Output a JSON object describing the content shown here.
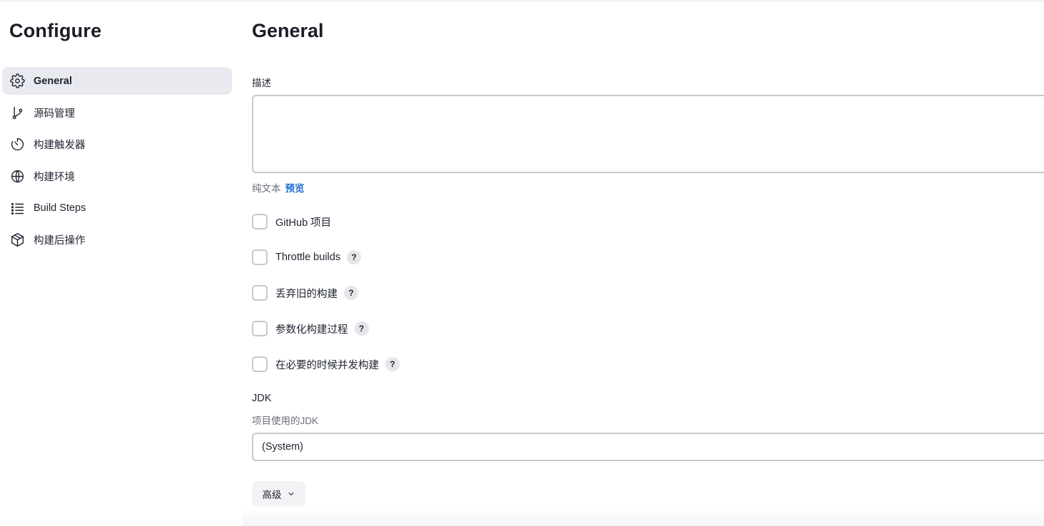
{
  "sidebar": {
    "title": "Configure",
    "items": [
      {
        "label": "General",
        "icon": "gear-icon",
        "active": true
      },
      {
        "label": "源码管理",
        "icon": "branch-icon"
      },
      {
        "label": "构建触发器",
        "icon": "timer-icon"
      },
      {
        "label": "构建环境",
        "icon": "globe-icon"
      },
      {
        "label": "Build Steps",
        "icon": "list-icon"
      },
      {
        "label": "构建后操作",
        "icon": "package-icon"
      }
    ]
  },
  "main": {
    "title": "General",
    "description": {
      "label": "描述",
      "value": "",
      "plain_text": "纯文本",
      "preview": "预览"
    },
    "options": [
      {
        "label": "GitHub 项目",
        "checked": false,
        "help": false
      },
      {
        "label": "Throttle builds",
        "checked": false,
        "help": true
      },
      {
        "label": "丢弃旧的构建",
        "checked": false,
        "help": true
      },
      {
        "label": "参数化构建过程",
        "checked": false,
        "help": true
      },
      {
        "label": "在必要的时候并发构建",
        "checked": false,
        "help": true
      }
    ],
    "help_glyph": "?",
    "jdk": {
      "label": "JDK",
      "help_text": "项目使用的JDK",
      "selected": "(System)"
    },
    "advanced_label": "高级"
  }
}
